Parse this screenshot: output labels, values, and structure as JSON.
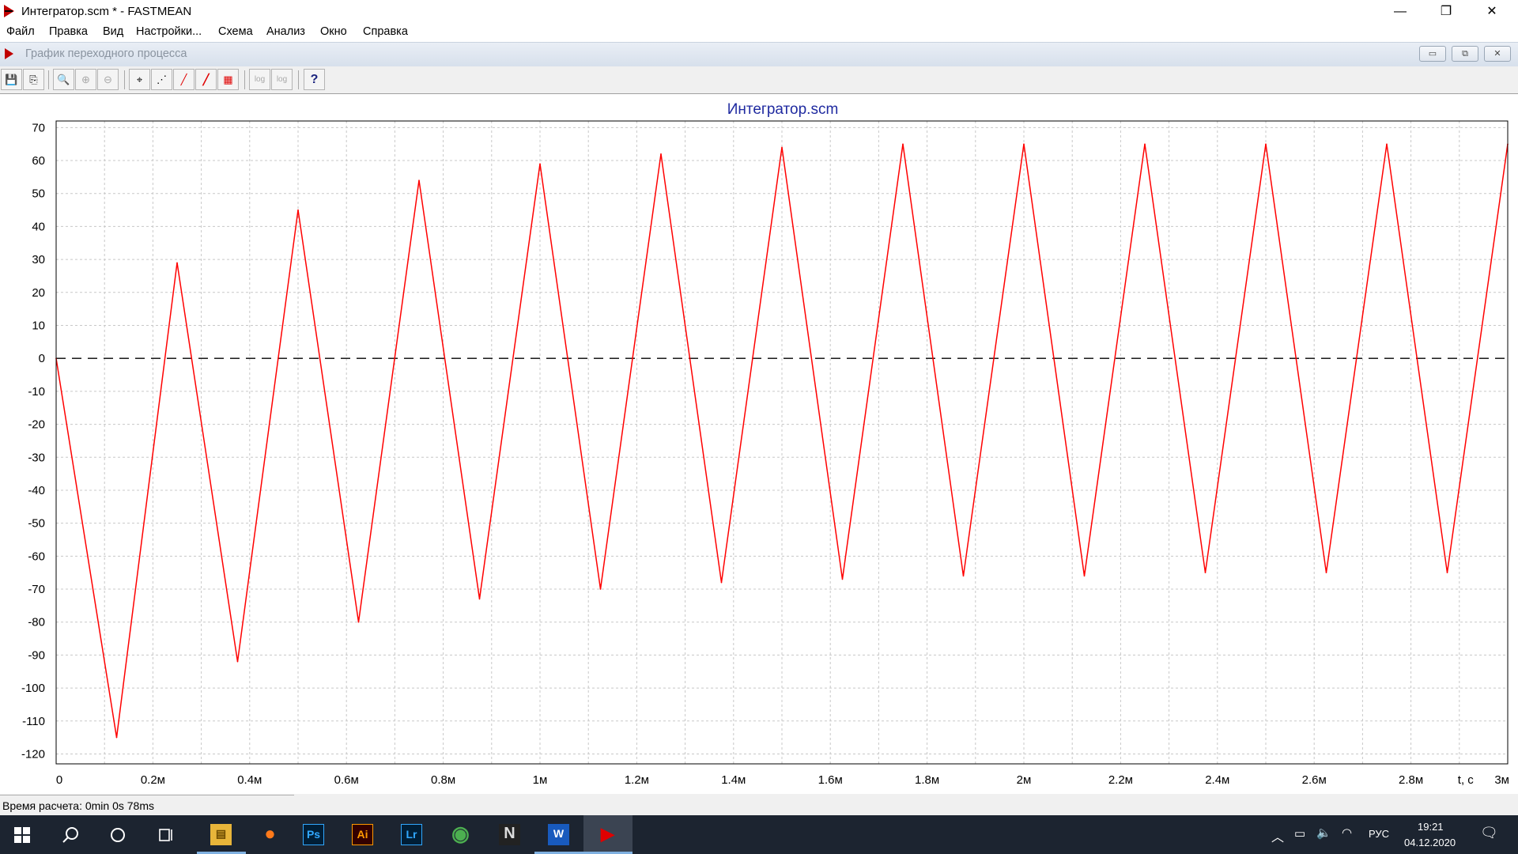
{
  "window": {
    "title": "Интегратор.scm * - FASTMEAN",
    "minimize": "—",
    "restore": "❐",
    "close": "✕"
  },
  "menu": [
    "Файл",
    "Правка",
    "Вид",
    "Настройки...",
    "Схема",
    "Анализ",
    "Окно",
    "Справка"
  ],
  "child_window": {
    "title": "График переходного процесса",
    "minimize": "▭",
    "restore": "⧉",
    "close": "✕"
  },
  "toolbar": {
    "buttons": [
      {
        "icon": "save-icon",
        "glyph": "💾"
      },
      {
        "icon": "copy-icon",
        "glyph": "⎘"
      },
      {
        "icon": "zoom-icon",
        "glyph": "🔍"
      },
      {
        "icon": "zoom-in-icon",
        "glyph": "⊕"
      },
      {
        "icon": "zoom-out-icon",
        "glyph": "⊖"
      },
      {
        "icon": "marker-icon",
        "glyph": "⌖"
      },
      {
        "icon": "line-points-icon",
        "glyph": "⋰"
      },
      {
        "icon": "line-icon",
        "glyph": "╱"
      },
      {
        "icon": "thick-line-icon",
        "glyph": "╱"
      },
      {
        "icon": "grid-icon",
        "glyph": "▦"
      },
      {
        "icon": "log-x-icon",
        "glyph": "log"
      },
      {
        "icon": "log-y-icon",
        "glyph": "log"
      },
      {
        "icon": "help-icon",
        "glyph": "?"
      }
    ]
  },
  "chart_data": {
    "type": "line",
    "title": "Интегратор.scm",
    "xlabel": "t, c",
    "ylabel": "",
    "xlim": [
      0,
      3
    ],
    "ylim": [
      -123,
      72
    ],
    "x_unit": "ms",
    "grid": true,
    "x_ticks": [
      0,
      0.2,
      0.4,
      0.6,
      0.8,
      1.0,
      1.2,
      1.4,
      1.6,
      1.8,
      2.0,
      2.2,
      2.4,
      2.6,
      2.8,
      3.0
    ],
    "x_tick_labels": [
      "0",
      "0.2м",
      "0.4м",
      "0.6м",
      "0.8м",
      "1м",
      "1.2м",
      "1.4м",
      "1.6м",
      "1.8м",
      "2м",
      "2.2м",
      "2.4м",
      "2.6м",
      "2.8м",
      "3м"
    ],
    "y_ticks": [
      70,
      60,
      50,
      40,
      30,
      20,
      10,
      0,
      -10,
      -20,
      -30,
      -40,
      -50,
      -60,
      -70,
      -80,
      -90,
      -100,
      -110,
      -120
    ],
    "y_tick_labels": [
      "70",
      "60",
      "50",
      "40",
      "30",
      "20",
      "10",
      "0",
      "-10",
      "-20",
      "-30",
      "-40",
      "-50",
      "-60",
      "-70",
      "-80",
      "-90",
      "-100",
      "-110",
      "-120"
    ],
    "zero_line": {
      "y": 0,
      "style": "dashed",
      "color": "#000000"
    },
    "series": [
      {
        "color": "#ff0000",
        "x": [
          0,
          0.125,
          0.25,
          0.375,
          0.5,
          0.625,
          0.75,
          0.875,
          1.0,
          1.125,
          1.25,
          1.375,
          1.5,
          1.625,
          1.75,
          1.875,
          2.0,
          2.125,
          2.25,
          2.375,
          2.5,
          2.625,
          2.75,
          2.875,
          3.0
        ],
        "y": [
          0,
          -115,
          29,
          -92,
          45,
          -80,
          54,
          -73,
          59,
          -70,
          62,
          -68,
          64,
          -67,
          65,
          -66,
          65,
          -66,
          65,
          -65,
          65,
          -65,
          65,
          -65,
          65
        ]
      }
    ]
  },
  "status": {
    "calc_time": "Время расчета: 0min 0s 78ms"
  },
  "taskbar": {
    "apps": [
      {
        "name": "explorer",
        "label": "▤",
        "bg": "#e8b53a",
        "fg": "#6b4a00"
      },
      {
        "name": "yandex",
        "label": "●",
        "bg": "transparent",
        "fg": "#ff7a1a"
      },
      {
        "name": "photoshop",
        "label": "Ps",
        "bg": "#001e36",
        "fg": "#31a8ff"
      },
      {
        "name": "illustrator",
        "label": "Ai",
        "bg": "#330000",
        "fg": "#ff9a00"
      },
      {
        "name": "lightroom",
        "label": "Lr",
        "bg": "#001e36",
        "fg": "#31a8ff"
      },
      {
        "name": "chrome",
        "label": "◉",
        "bg": "transparent",
        "fg": "#4caf50"
      },
      {
        "name": "notion",
        "label": "N",
        "bg": "#222",
        "fg": "#ddd"
      },
      {
        "name": "word",
        "label": "W",
        "bg": "#185abd",
        "fg": "#ffffff"
      },
      {
        "name": "fastmean",
        "label": "▶",
        "bg": "transparent",
        "fg": "#e00000"
      }
    ],
    "language": "РУС",
    "time": "19:21",
    "date": "04.12.2020"
  }
}
